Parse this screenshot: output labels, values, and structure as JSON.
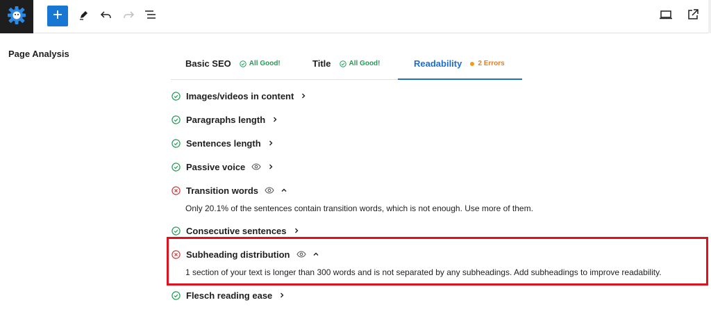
{
  "panel": {
    "title": "Page Analysis"
  },
  "tabs": [
    {
      "label": "Basic SEO",
      "status": "All Good!",
      "status_type": "good"
    },
    {
      "label": "Title",
      "status": "All Good!",
      "status_type": "good"
    },
    {
      "label": "Readability",
      "status": "2 Errors",
      "status_type": "error",
      "active": true
    }
  ],
  "checks": [
    {
      "label": "Images/videos in content",
      "status": "pass"
    },
    {
      "label": "Paragraphs length",
      "status": "pass"
    },
    {
      "label": "Sentences length",
      "status": "pass"
    },
    {
      "label": "Passive voice",
      "status": "pass"
    },
    {
      "label": "Transition words",
      "status": "fail",
      "description": "Only 20.1% of the sentences contain transition words, which is not enough. Use more of them."
    },
    {
      "label": "Consecutive sentences",
      "status": "pass"
    },
    {
      "label": "Subheading distribution",
      "status": "fail",
      "description": "1 section of your text is longer than 300 words and is not separated by any subheadings. Add subheadings to improve readability."
    },
    {
      "label": "Flesch reading ease",
      "status": "pass"
    }
  ],
  "colors": {
    "accent": "#1b6fd4",
    "pass": "#1f9d55",
    "fail": "#d63638",
    "warning": "#f39c12",
    "highlight": "#e0101c"
  },
  "icons": {
    "logo": "gear-logo-icon",
    "add": "plus-icon",
    "edit": "pencil-icon",
    "undo": "undo-icon",
    "redo": "redo-icon",
    "outline": "list-view-icon",
    "preview": "desktop-icon",
    "external": "external-link-icon"
  }
}
